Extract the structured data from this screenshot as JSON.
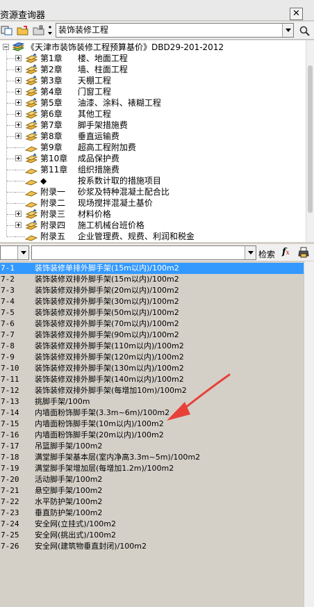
{
  "window": {
    "title": "资源查询器",
    "close_label": "✕"
  },
  "toolbar": {
    "dropdown_value": "装饰装修工程"
  },
  "tree": {
    "root": "《天津市装饰装修工程预算基价》DBD29-201-2012",
    "items": [
      {
        "num": "第1章",
        "label": "楼、地面工程",
        "expandable": true
      },
      {
        "num": "第2章",
        "label": "墙、柱面工程",
        "expandable": true
      },
      {
        "num": "第3章",
        "label": "天棚工程",
        "expandable": true
      },
      {
        "num": "第4章",
        "label": "门窗工程",
        "expandable": true
      },
      {
        "num": "第5章",
        "label": "油漆、涂料、裱糊工程",
        "expandable": true
      },
      {
        "num": "第6章",
        "label": "其他工程",
        "expandable": true
      },
      {
        "num": "第7章",
        "label": "脚手架措施费",
        "expandable": true
      },
      {
        "num": "第8章",
        "label": "垂直运输费",
        "expandable": true
      },
      {
        "num": "第9章",
        "label": "超高工程附加费",
        "expandable": false
      },
      {
        "num": "第10章",
        "label": "成品保护费",
        "expandable": true
      },
      {
        "num": "第11章",
        "label": "组织措施费",
        "expandable": false
      },
      {
        "num": "◆",
        "label": "按系数计取的措施项目",
        "expandable": false
      },
      {
        "num": "附录一",
        "label": "砂浆及特种混凝土配合比",
        "expandable": false
      },
      {
        "num": "附录二",
        "label": "现场搅拌混凝土基价",
        "expandable": false
      },
      {
        "num": "附录三",
        "label": "材料价格",
        "expandable": true
      },
      {
        "num": "附录四",
        "label": "施工机械台班价格",
        "expandable": true
      },
      {
        "num": "附录五",
        "label": "企业管理费、规费、利润和税金",
        "expandable": false
      }
    ]
  },
  "searchbar": {
    "search_label": "检索",
    "fx_label": "f",
    "fx_sub": "x"
  },
  "list": {
    "selected_index": 0,
    "rows": [
      {
        "code": "7-1",
        "name": "装饰装修单排外脚手架(15m以内)/100m2"
      },
      {
        "code": "7-2",
        "name": "装饰装修双排外脚手架(15m以内)/100m2"
      },
      {
        "code": "7-3",
        "name": "装饰装修双排外脚手架(20m以内)/100m2"
      },
      {
        "code": "7-4",
        "name": "装饰装修双排外脚手架(30m以内)/100m2"
      },
      {
        "code": "7-5",
        "name": "装饰装修双排外脚手架(50m以内)/100m2"
      },
      {
        "code": "7-6",
        "name": "装饰装修双排外脚手架(70m以内)/100m2"
      },
      {
        "code": "7-7",
        "name": "装饰装修双排外脚手架(90m以内)/100m2"
      },
      {
        "code": "7-8",
        "name": "装饰装修双排外脚手架(110m以内)/100m2"
      },
      {
        "code": "7-9",
        "name": "装饰装修双排外脚手架(120m以内)/100m2"
      },
      {
        "code": "7-10",
        "name": "装饰装修双排外脚手架(130m以内)/100m2"
      },
      {
        "code": "7-11",
        "name": "装饰装修双排外脚手架(140m以内)/100m2"
      },
      {
        "code": "7-12",
        "name": "装饰装修双排外脚手架(每增加10m)/100m2"
      },
      {
        "code": "7-13",
        "name": "挑脚手架/100m"
      },
      {
        "code": "7-14",
        "name": "内墙面粉饰脚手架(3.3m~6m)/100m2"
      },
      {
        "code": "7-15",
        "name": "内墙面粉饰脚手架(10m以内)/100m2"
      },
      {
        "code": "7-16",
        "name": "内墙面粉饰脚手架(20m以内)/100m2"
      },
      {
        "code": "7-17",
        "name": "吊篮脚手架/100m2"
      },
      {
        "code": "7-18",
        "name": "满堂脚手架基本层(室内净高3.3m~5m)/100m2"
      },
      {
        "code": "7-19",
        "name": "满堂脚手架增加层(每增加1.2m)/100m2"
      },
      {
        "code": "7-20",
        "name": "活动脚手架/100m2"
      },
      {
        "code": "7-21",
        "name": "悬空脚手架/100m2"
      },
      {
        "code": "7-22",
        "name": "水平防护架/100m2"
      },
      {
        "code": "7-23",
        "name": "垂直防护架/100m2"
      },
      {
        "code": "7-24",
        "name": "安全网(立挂式)/100m2"
      },
      {
        "code": "7-25",
        "name": "安全网(挑出式)/100m2"
      },
      {
        "code": "7-26",
        "name": "安全网(建筑物垂直封闭)/100m2"
      }
    ]
  },
  "colors": {
    "selection": "#3399ff",
    "annotation_arrow": "#e8413a",
    "list_bg": "#d4d0c8"
  }
}
